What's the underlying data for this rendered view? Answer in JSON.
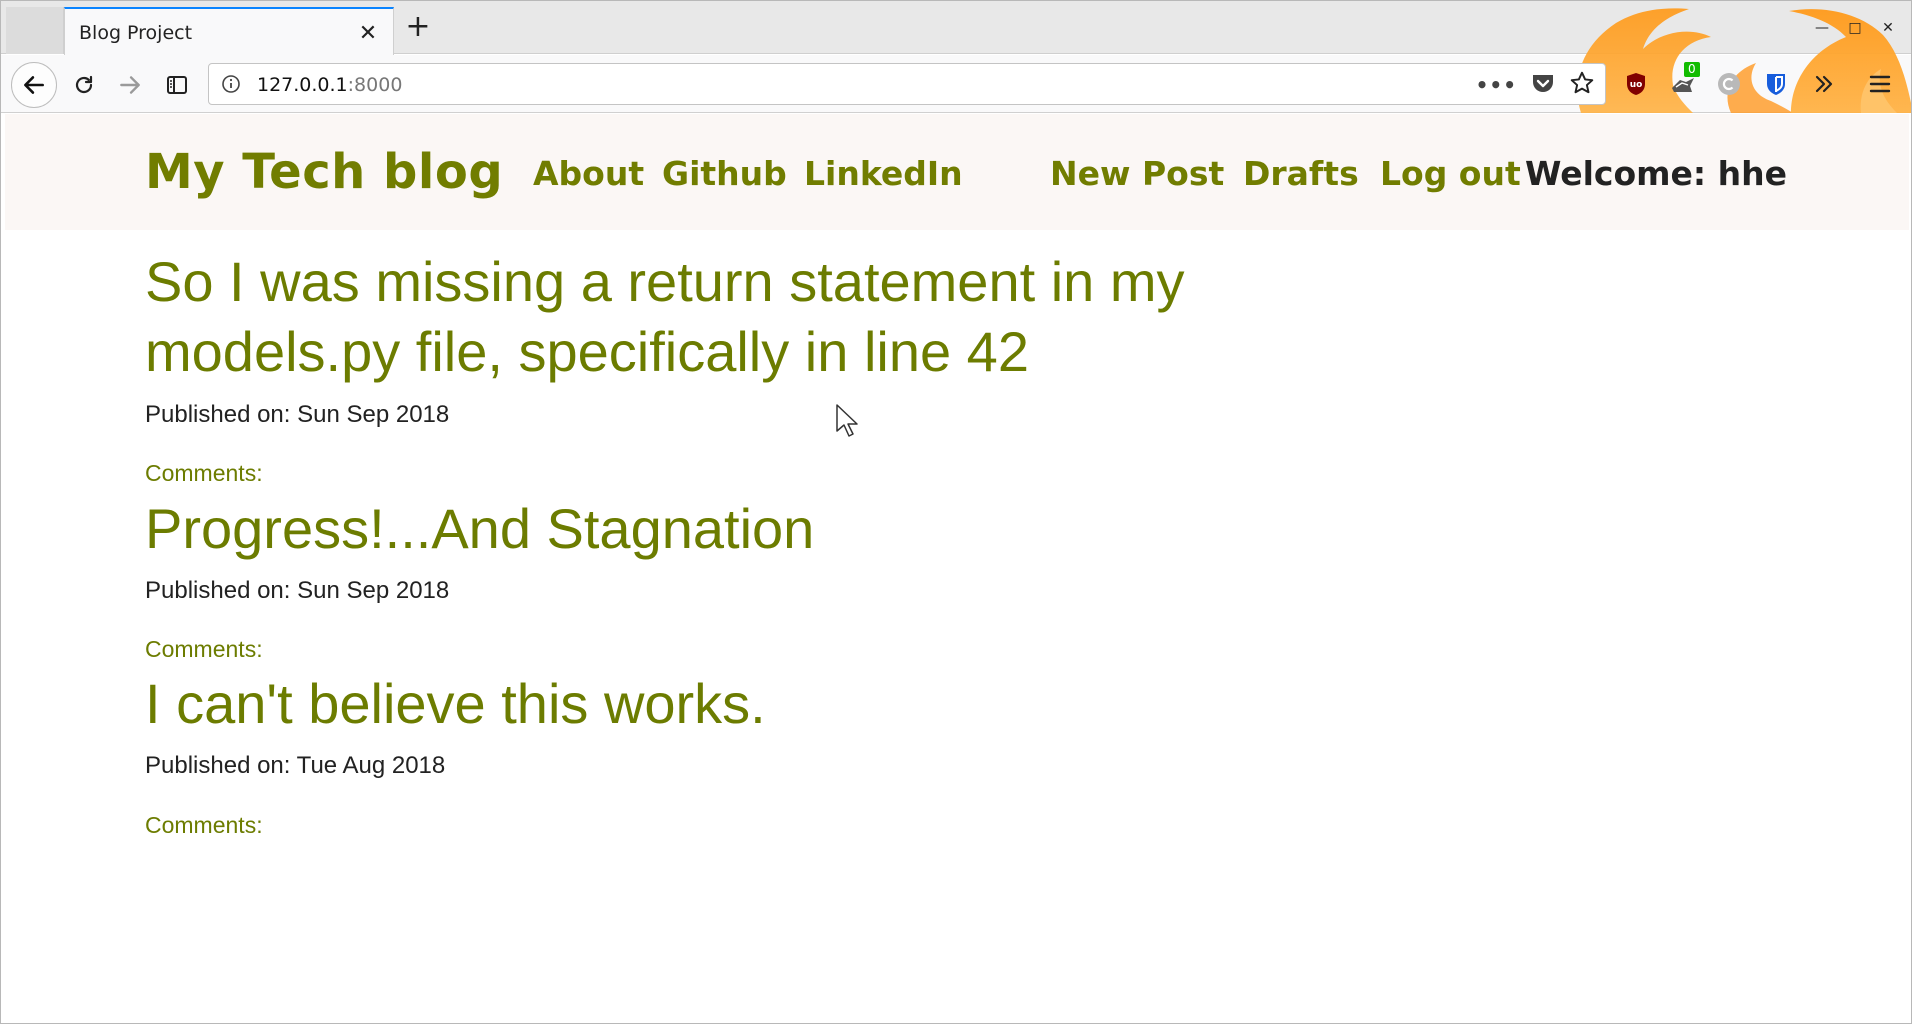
{
  "browser": {
    "tab_title": "Blog Project",
    "url_host": "127.0.0.1",
    "url_port": ":8000",
    "extension_badge": "0"
  },
  "site": {
    "brand": "My Tech blog",
    "nav": {
      "about": "About",
      "github": "Github",
      "linkedin": "LinkedIn",
      "new_post": "New Post",
      "drafts": "Drafts",
      "logout": "Log out"
    },
    "welcome": "Welcome: hhe"
  },
  "posts": [
    {
      "title": "So I was missing a return statement in my models.py file, specifically in line 42",
      "published": "Published on: Sun Sep 2018",
      "comments_label": "Comments:"
    },
    {
      "title": "Progress!...And Stagnation",
      "published": "Published on: Sun Sep 2018",
      "comments_label": "Comments:"
    },
    {
      "title": "I can't believe this works.",
      "published": "Published on: Tue Aug 2018",
      "comments_label": "Comments:"
    }
  ],
  "colors": {
    "accent": "#6c7c00",
    "header_bg": "#fbf7f5",
    "tab_indicator": "#0a84ff"
  }
}
